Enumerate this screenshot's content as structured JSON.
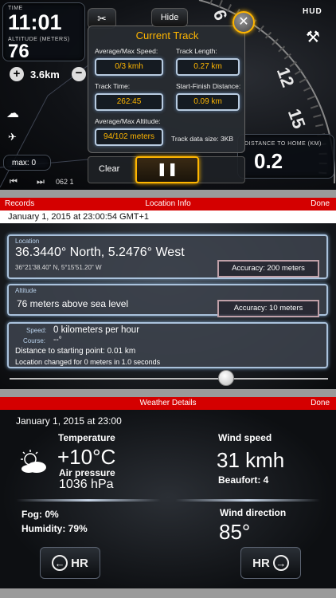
{
  "hud": {
    "time_label": "TIME",
    "time": "11:01",
    "altitude_label": "ALTITUDE (METERS)",
    "altitude": "76",
    "distance": "3.6km",
    "hud_label": "HUD",
    "max_label": "max: 0",
    "heading": "062 1",
    "distance_home_label": "DISTANCE TO HOME (KM)",
    "distance_home": "0.2",
    "hide_label": "Hide",
    "clear_label": "Clear",
    "dial_6": "6",
    "dial_12": "12",
    "dial_15": "15"
  },
  "track": {
    "title": "Current Track",
    "avg_max_speed_label": "Average/Max Speed:",
    "avg_max_speed": "0/3 kmh",
    "track_length_label": "Track Length:",
    "track_length": "0.27 km",
    "track_time_label": "Track Time:",
    "track_time": "262:45",
    "start_finish_label": "Start-Finish Distance:",
    "start_finish": "0.09 km",
    "avg_max_alt_label": "Average/Max Altitude:",
    "avg_max_alt": "94/102 meters",
    "data_size": "Track data size: 3KB"
  },
  "location": {
    "records_label": "Records",
    "title": "Location Info",
    "done_label": "Done",
    "datetime": "January 1, 2015 at 23:00:54 GMT+1",
    "location_label": "Location",
    "coords": "36.3440° North, 5.2476° West",
    "coords_dms": "36°21'38.40\" N, 5°15'51.20\" W",
    "accuracy1": "Accuracy: 200 meters",
    "altitude_label": "Altitude",
    "altitude_text": "76 meters above sea level",
    "accuracy2": "Accuracy: 10 meters",
    "speed_label": "Speed:",
    "speed_value": "0 kilometers per hour",
    "course_label": "Course:",
    "course_value": "--°",
    "distance_start": "Distance to starting point: 0.01 km",
    "changed": "Location changed for 0 meters in 1.0 seconds",
    "slider_fraction": 0.68
  },
  "weather": {
    "title": "Weather Details",
    "done_label": "Done",
    "date": "January 1, 2015 at 23:00",
    "temperature_label": "Temperature",
    "temperature": "+10°C",
    "pressure_label": "Air pressure",
    "pressure": "1036 hPa",
    "wind_speed_label": "Wind speed",
    "wind_speed": "31 kmh",
    "beaufort": "Beaufort: 4",
    "fog": "Fog: 0%",
    "humidity": "Humidity: 79%",
    "wind_dir_label": "Wind direction",
    "wind_dir": "85°",
    "hr_left": "HR",
    "hr_right": "HR"
  },
  "colors": {
    "accent_red": "#d40000",
    "value_orange": "#ffb600",
    "glow_blue": "#aac2dc"
  }
}
